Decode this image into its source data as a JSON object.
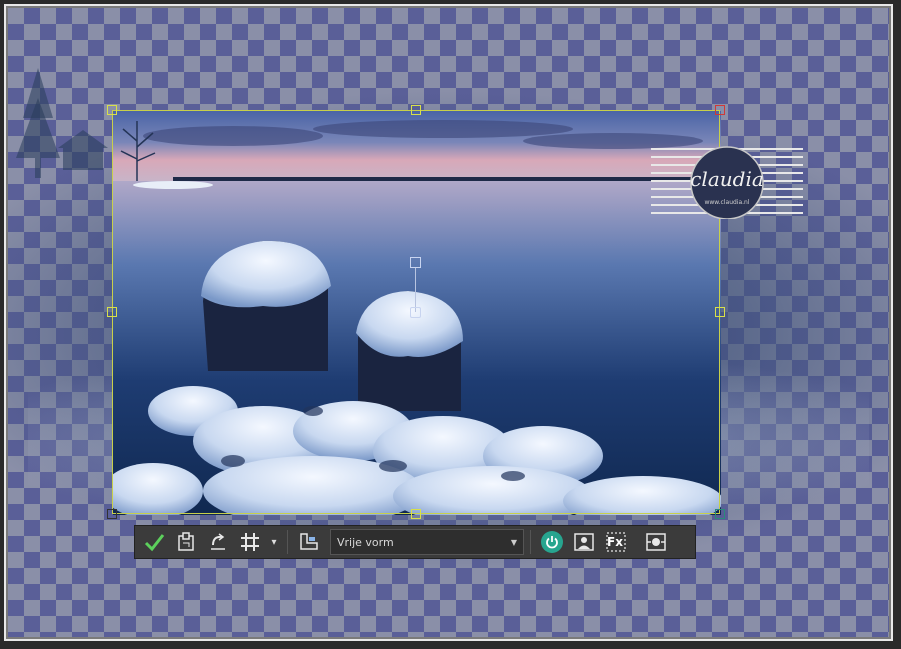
{
  "canvas": {
    "checker_dark": "#5a5f98",
    "checker_light": "#8a8fa8",
    "selection_color": "#c8d04a"
  },
  "logo": {
    "text": "claudia",
    "subtext": "www.claudia.nl"
  },
  "toolbar": {
    "apply": "apply-check-icon",
    "dropdown": {
      "selected": "Vrije vorm"
    },
    "icons": [
      "apply-check-icon",
      "transform-icon",
      "rotate-back-icon",
      "grid-icon",
      "grid-dropdown-icon",
      "perspective-icon",
      "power-icon",
      "portrait-icon",
      "fx-icon",
      "fit-screen-icon"
    ],
    "fx_label": "Fx",
    "power_color": "#27a58f"
  }
}
